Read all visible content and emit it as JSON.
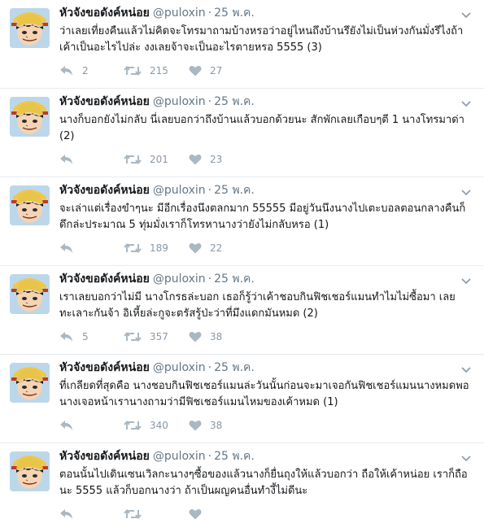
{
  "icons": {
    "reply": "reply-icon",
    "retweet": "retweet-icon",
    "like": "heart-icon",
    "more": "chevron-down-icon"
  },
  "colors": {
    "name": "#14171a",
    "meta": "#657786",
    "action": "#8899a6",
    "divider": "#e6ecf0"
  },
  "tweets": [
    {
      "name": "หัวจังขอดังค์หน่อย",
      "handle": "@puloxin",
      "sep": "·",
      "time": "25 พ.ค.",
      "text": "ว่าเลยเที่ยงคืนแล้วไม่คิดจะโทรมาถามบ้างหรอว่าอยู่ไหนถึงบ้านรึยังไม่เป็นห่วงกันมั่งรึไงถ้าเค้าเป็นอะไรไปล่ะ งงเลยจ้าจะเป็นอะไรตายหรอ 5555 (3)",
      "replies": "2",
      "retweets": "215",
      "likes": "27"
    },
    {
      "name": "หัวจังขอดังค์หน่อย",
      "handle": "@puloxin",
      "sep": "·",
      "time": "25 พ.ค.",
      "text": "นางก็บอกยังไม่กลับ นี่เลยบอกว่าถึงบ้านแล้วบอกด้วยนะ สักพักเลยเกือบๆตี 1 นางโทรมาด่า (2)",
      "replies": "",
      "retweets": "201",
      "likes": "23"
    },
    {
      "name": "หัวจังขอดังค์หน่อย",
      "handle": "@puloxin",
      "sep": "·",
      "time": "25 พ.ค.",
      "text": "จะเล่าแต่เรื่องขำๆนะ มีอีกเรื่องนึงตลกมาก 55555 มีอยู่วันนึงนางไปเตะบอลตอนกลางคืนก็ดึกล่ะประมาณ 5 ทุ่มมั่งเราก็โทรหานางว่ายังไม่กลับหรอ (1)",
      "replies": "",
      "retweets": "189",
      "likes": "22"
    },
    {
      "name": "หัวจังขอดังค์หน่อย",
      "handle": "@puloxin",
      "sep": "·",
      "time": "25 พ.ค.",
      "text": "เราเลยบอกว่าไม่มี นางโกรธล่ะบอก เธอก็รู้ว่าเค้าชอบกินฟิชเชอร์แมนทำไมไม่ซื้อมา เลยทะเลาะกันจ้า อิเหี้ยล่ะกูจะตรัสรู้ป่ะว่าที่มึงแดกมันหมด (2)",
      "replies": "5",
      "retweets": "357",
      "likes": "38"
    },
    {
      "name": "หัวจังขอดังค์หน่อย",
      "handle": "@puloxin",
      "sep": "·",
      "time": "25 พ.ค.",
      "text": "ที่เกลียดที่สุดคือ นางชอบกินฟิชเชอร์แมนล่ะวันนั้นก่อนจะมาเจอกันฟิชเชอร์แมนนางหมดพอนางเจอหน้าเรานางถามว่ามีฟิชเชอร์แมนไหมของเค้าหมด (1)",
      "replies": "",
      "retweets": "340",
      "likes": "38"
    },
    {
      "name": "หัวจังขอดังค์หน่อย",
      "handle": "@puloxin",
      "sep": "·",
      "time": "25 พ.ค.",
      "text": "ตอนนั้นไปเดินเซนเวิลกะนางๆซื้อของแล้วนางก็ยื่นถุงให้แล้วบอกว่า ถือให้เค้าหน่อย เราก็ถือนะ 5555 แล้วก็บอกนางว่า ถ้าเป็นผญคนอื่นทำงี้ไม่ดีนะ",
      "replies": "",
      "retweets": "",
      "likes": ""
    }
  ]
}
